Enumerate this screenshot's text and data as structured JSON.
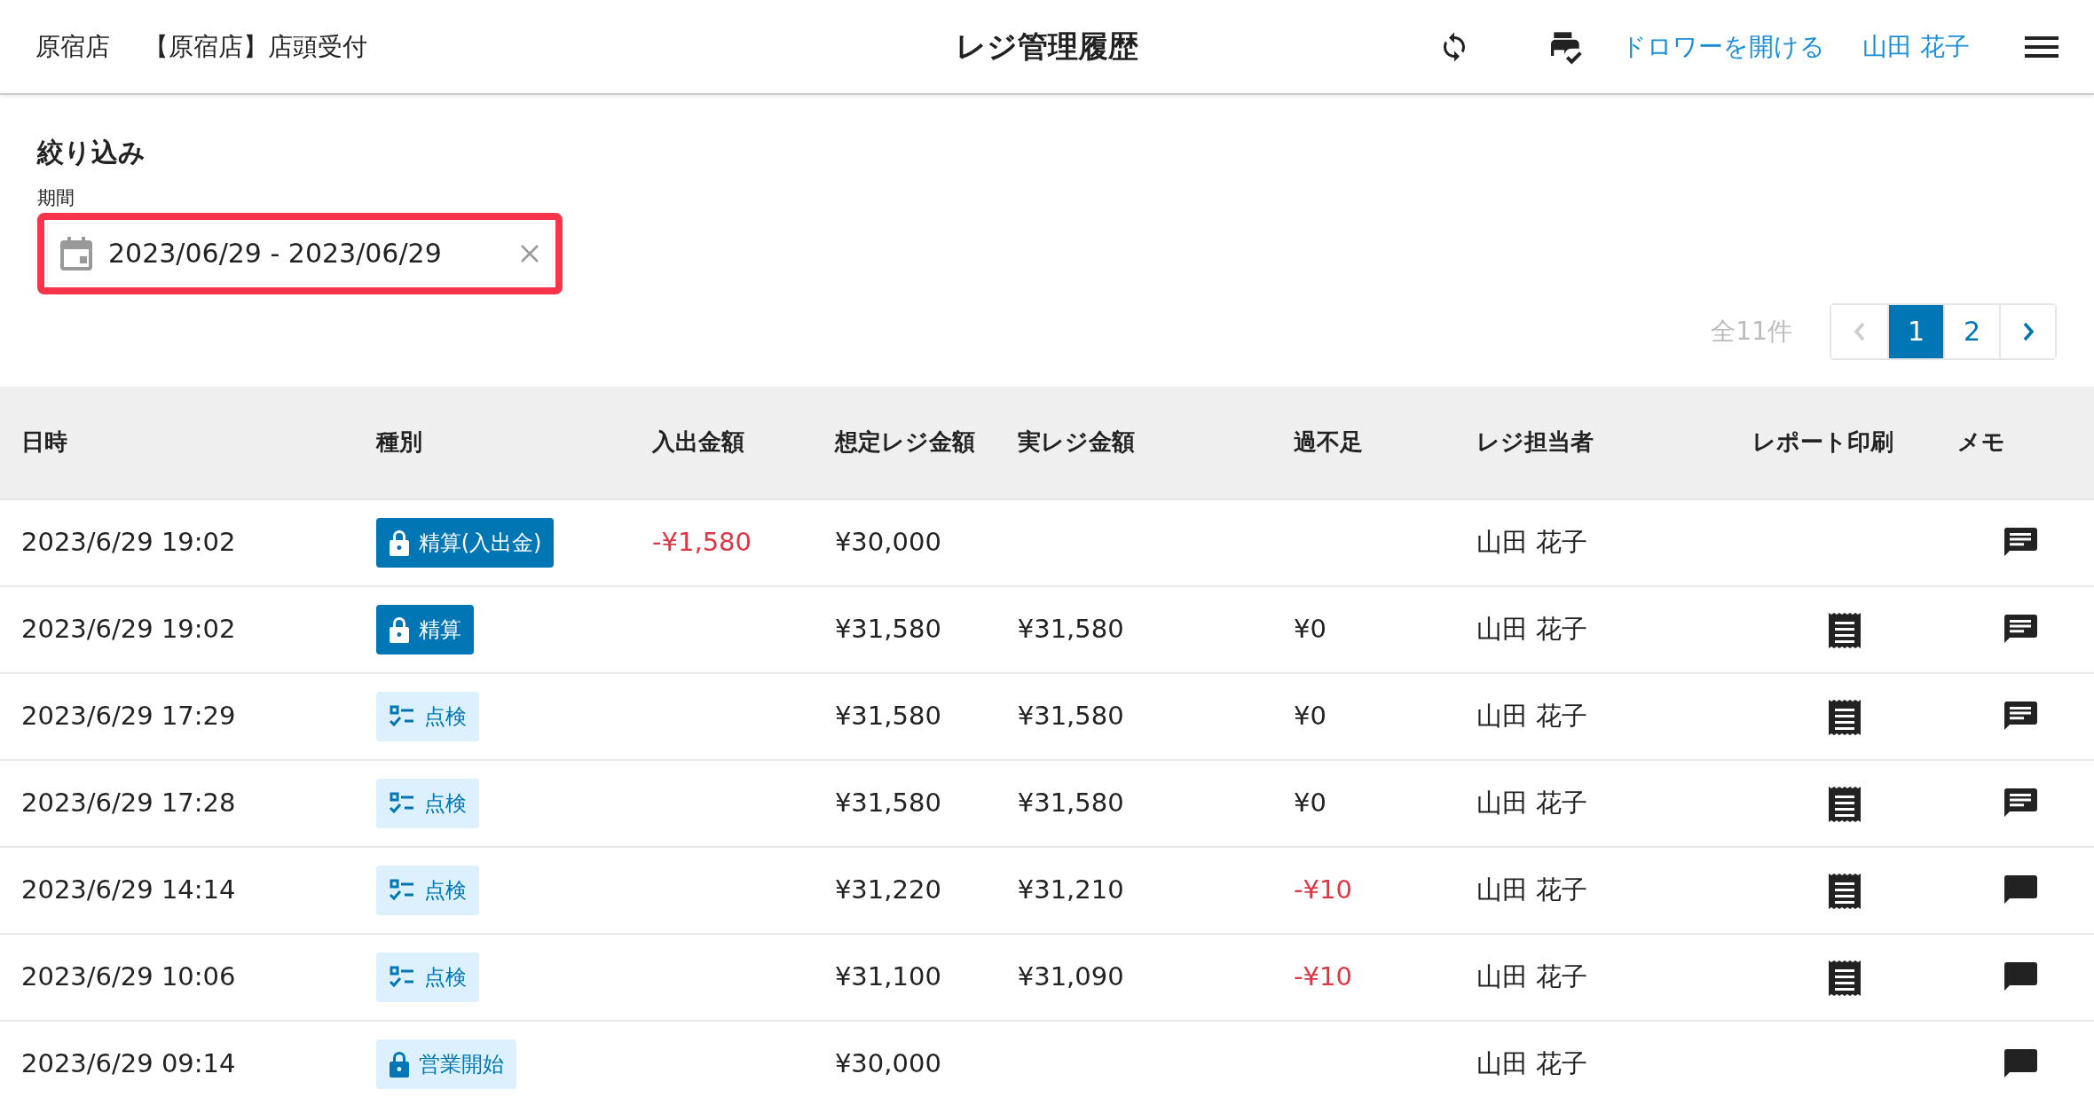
{
  "header": {
    "store": "原宿店",
    "register": "【原宿店】店頭受付",
    "title": "レジ管理履歴",
    "drawer_link": "ドロワーを開ける",
    "user": "山田 花子"
  },
  "filter": {
    "heading": "絞り込み",
    "period_label": "期間",
    "period_value": "2023/06/29 - 2023/06/29",
    "highlighted": true
  },
  "pagination": {
    "total": "全11件",
    "prev_disabled": true,
    "pages": [
      {
        "label": "1",
        "selected": true
      },
      {
        "label": "2",
        "selected": false
      }
    ]
  },
  "table": {
    "columns": [
      "日時",
      "種別",
      "入出金額",
      "想定レジ金額",
      "実レジ金額",
      "過不足",
      "レジ担当者",
      "レポート印刷",
      "メモ"
    ],
    "rows": [
      {
        "datetime": "2023/6/29 19:02",
        "type": {
          "label": "精算(入出金)",
          "kind": "lock",
          "filled": true
        },
        "amount": {
          "text": "-¥1,580",
          "negative": true
        },
        "expected": "¥30,000",
        "staff": "山田 花子",
        "report": false,
        "memo": true
      },
      {
        "datetime": "2023/6/29 19:02",
        "type": {
          "label": "精算",
          "kind": "lock",
          "filled": true
        },
        "expected": "¥31,580",
        "actual": "¥31,580",
        "diff": {
          "text": "¥0",
          "negative": false
        },
        "staff": "山田 花子",
        "report": true,
        "memo": true
      },
      {
        "datetime": "2023/6/29 17:29",
        "type": {
          "label": "点検",
          "kind": "checklist",
          "filled": false
        },
        "expected": "¥31,580",
        "actual": "¥31,580",
        "diff": {
          "text": "¥0",
          "negative": false
        },
        "staff": "山田 花子",
        "report": true,
        "memo": true
      },
      {
        "datetime": "2023/6/29 17:28",
        "type": {
          "label": "点検",
          "kind": "checklist",
          "filled": false
        },
        "expected": "¥31,580",
        "actual": "¥31,580",
        "diff": {
          "text": "¥0",
          "negative": false
        },
        "staff": "山田 花子",
        "report": true,
        "memo": true
      },
      {
        "datetime": "2023/6/29 14:14",
        "type": {
          "label": "点検",
          "kind": "checklist",
          "filled": false
        },
        "expected": "¥31,220",
        "actual": "¥31,210",
        "diff": {
          "text": "-¥10",
          "negative": true
        },
        "staff": "山田 花子",
        "report": true,
        "memo": false
      },
      {
        "datetime": "2023/6/29 10:06",
        "type": {
          "label": "点検",
          "kind": "checklist",
          "filled": false
        },
        "expected": "¥31,100",
        "actual": "¥31,090",
        "diff": {
          "text": "-¥10",
          "negative": true
        },
        "staff": "山田 花子",
        "report": true,
        "memo": false
      },
      {
        "datetime": "2023/6/29 09:14",
        "type": {
          "label": "営業開始",
          "kind": "lock",
          "filled": false
        },
        "expected": "¥30,000",
        "staff": "山田 花子",
        "report": false,
        "memo": false
      }
    ]
  }
}
